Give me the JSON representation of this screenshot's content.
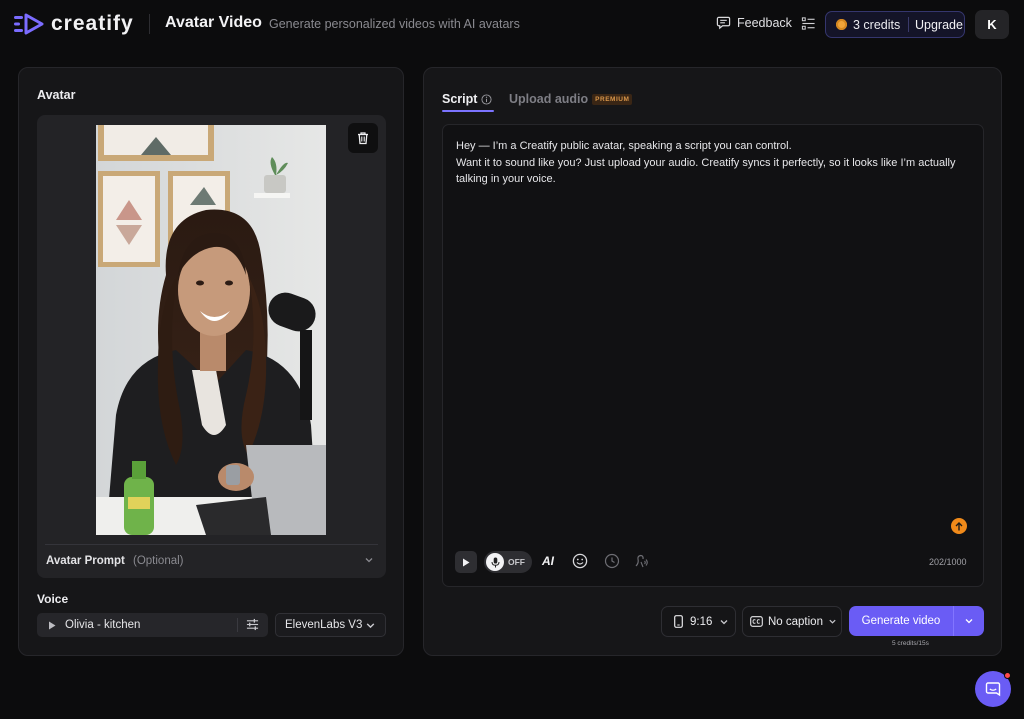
{
  "brand": {
    "name": "creatify"
  },
  "header": {
    "title": "Avatar Video",
    "subtitle": "Generate personalized videos with AI avatars",
    "feedback_label": "Feedback",
    "credits_label": "3 credits",
    "upgrade_label": "Upgrade",
    "user_initial": "K"
  },
  "avatar_panel": {
    "heading": "Avatar",
    "prompt_label": "Avatar Prompt",
    "prompt_optional": "(Optional)",
    "voice_heading": "Voice",
    "voice_name": "Olivia - kitchen",
    "voice_model": "ElevenLabs V3"
  },
  "script_panel": {
    "tabs": [
      {
        "label": "Script",
        "active": true
      },
      {
        "label": "Upload audio",
        "badge": "PREMIUM",
        "active": false
      }
    ],
    "script_lines": [
      "Hey — I’m a Creatify public avatar, speaking a script you can control.",
      "Want it to sound like you? Just upload your audio. Creatify syncs it perfectly, so it looks like I’m actually talking in your voice."
    ],
    "mic_state": "OFF",
    "ai_label": "AI",
    "char_count": "202/1000",
    "aspect_ratio": "9:16",
    "caption": "No caption",
    "generate_label": "Generate video",
    "generate_cost": "5 credits/15s"
  },
  "colors": {
    "accent": "#6a5cf5",
    "premium": "#d9964a",
    "notify": "#ff4a4a",
    "upload_dot": "#f08a1a"
  },
  "icons": [
    "logo-icon",
    "feedback-icon",
    "list-settings-icon",
    "coin-icon",
    "trash-icon",
    "chevron-down-icon",
    "play-icon",
    "sliders-icon",
    "info-icon",
    "mic-icon",
    "emoji-icon",
    "clock-icon",
    "voice-effects-icon",
    "upload-arrow-icon",
    "phone-icon",
    "cc-icon",
    "chat-icon"
  ]
}
